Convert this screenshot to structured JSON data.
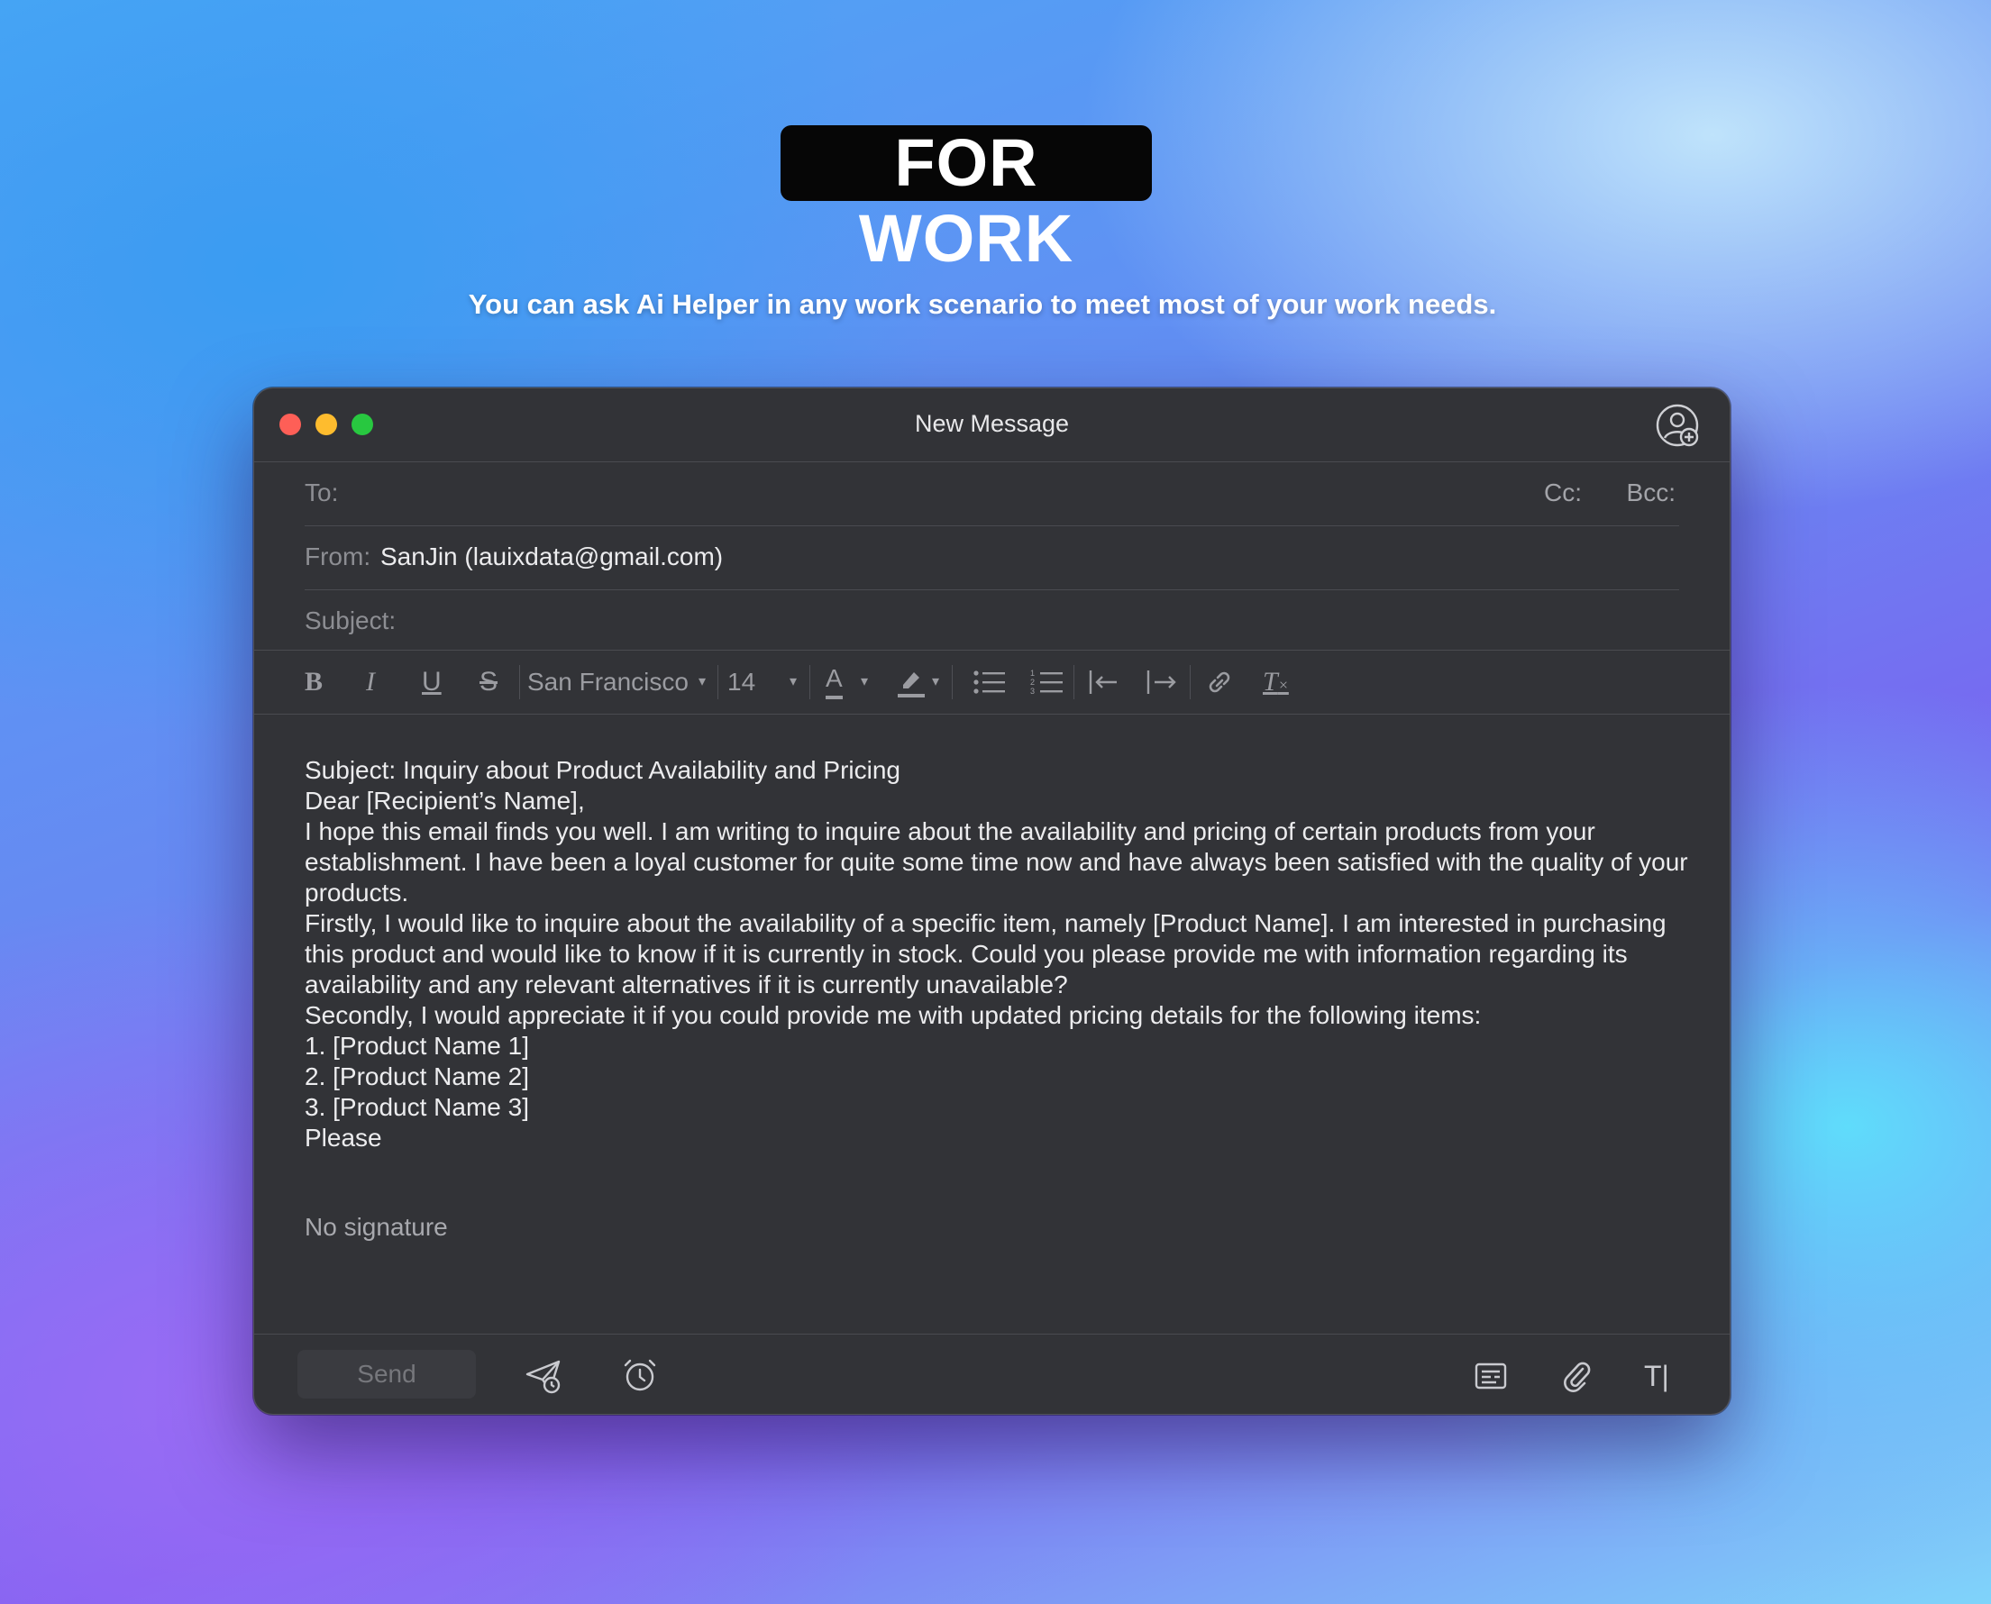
{
  "hero": {
    "title": "FOR WORK",
    "subtitle": "You can ask Ai Helper in any work scenario to meet most of your work needs."
  },
  "window": {
    "title": "New Message",
    "icons": [
      "close-button",
      "minimize-button",
      "zoom-button",
      "add-contact-icon"
    ]
  },
  "header_fields": {
    "to_label": "To:",
    "cc_label": "Cc:",
    "bcc_label": "Bcc:",
    "from_label": "From:",
    "from_value": "SanJin (lauixdata@gmail.com)",
    "subject_label": "Subject:"
  },
  "toolbar": {
    "bold": "B",
    "italic": "I",
    "underline": "U",
    "strike": "S",
    "font_family": "San Francisco",
    "font_size": "14",
    "text_color": "A",
    "clear_format": "T"
  },
  "body": {
    "lines": [
      "Subject: Inquiry about Product Availability and Pricing",
      "Dear [Recipient’s Name],",
      "I hope this email finds you well. I am writing to inquire about the availability and pricing of certain products from your establishment. I have been a loyal customer for quite some time now and have always been satisfied with the quality of your products.",
      "Firstly, I would like to inquire about the availability of a specific item, namely [Product Name]. I am interested in purchasing this product and would like to know if it is currently in stock. Could you please provide me with information regarding its availability and any relevant alternatives if it is currently unavailable?",
      "Secondly, I would appreciate it if you could provide me with updated pricing details for the following items:",
      "1. [Product Name 1]",
      "2. [Product Name 2]",
      "3. [Product Name 3]",
      "Please"
    ],
    "signature": "No signature"
  },
  "bottom": {
    "send_label": "Send",
    "icons": [
      "send-later-icon",
      "reminder-icon",
      "template-icon",
      "attachment-icon",
      "text-format-icon"
    ],
    "text_format_label": "T|"
  }
}
